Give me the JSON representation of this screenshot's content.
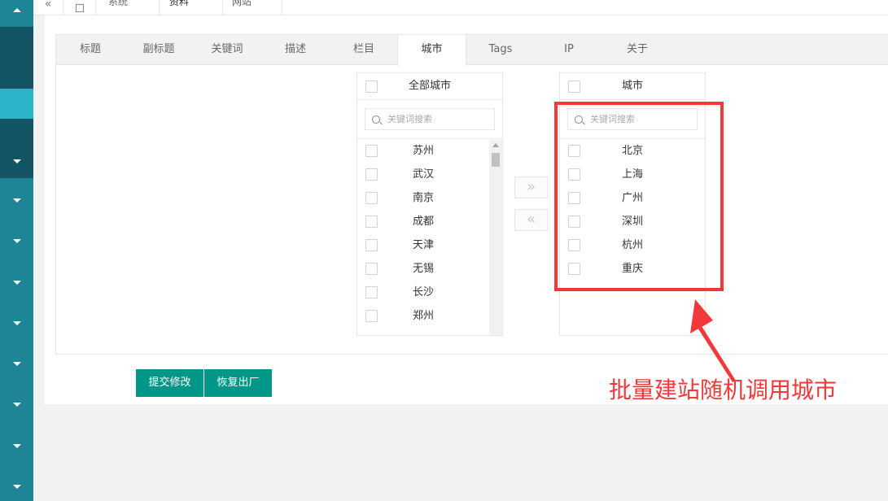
{
  "top_tabs": [
    {
      "label": "系统"
    },
    {
      "label": "资料"
    },
    {
      "label": "网站"
    }
  ],
  "settings_tabs": [
    {
      "label": "标题"
    },
    {
      "label": "副标题"
    },
    {
      "label": "关键词"
    },
    {
      "label": "描述"
    },
    {
      "label": "栏目"
    },
    {
      "label": "城市",
      "active": true
    },
    {
      "label": "Tags"
    },
    {
      "label": "IP"
    },
    {
      "label": "关于"
    }
  ],
  "transfer": {
    "left": {
      "title": "全部城市",
      "search_placeholder": "关键词搜索",
      "items": [
        "苏州",
        "武汉",
        "南京",
        "成都",
        "天津",
        "无锡",
        "长沙",
        "郑州"
      ]
    },
    "right": {
      "title": "城市",
      "search_placeholder": "关键词搜索",
      "items": [
        "北京",
        "上海",
        "广州",
        "深圳",
        "杭州",
        "重庆"
      ]
    },
    "move_right_label": "»",
    "move_left_label": "«"
  },
  "buttons": {
    "submit": "提交修改",
    "reset": "恢复出厂"
  },
  "annotation": "批量建站随机调用城市",
  "colors": {
    "sidebar": "#1d8596",
    "sidebar_dark": "#125463",
    "sidebar_active": "#2ab5c9",
    "primary_button": "#009688",
    "annotation_red": "#f2383a"
  }
}
